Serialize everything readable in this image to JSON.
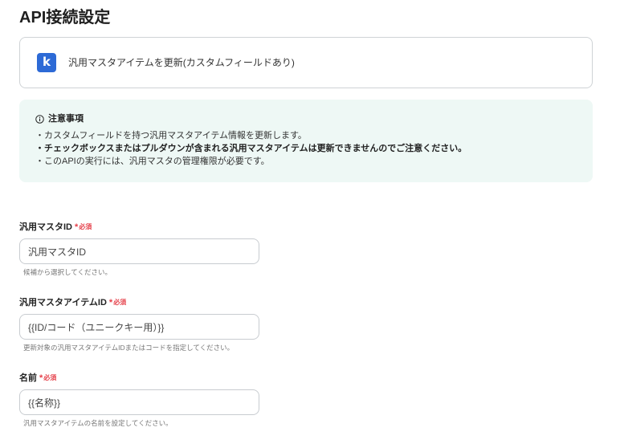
{
  "page": {
    "title": "API接続設定"
  },
  "colors": {
    "required": "#e5404a",
    "notice_bg": "#eef8f5",
    "app_icon": "#2d6ad6"
  },
  "action_card": {
    "icon": "kintone-logo-icon",
    "icon_letter": "k",
    "label": "汎用マスタアイテムを更新(カスタムフィールドあり)"
  },
  "notice": {
    "icon": "info-icon",
    "heading": "注意事項",
    "items": [
      "・カスタムフィールドを持つ汎用マスタアイテム情報を更新します。",
      "・チェックボックスまたはプルダウンが含まれる汎用マスタアイテムは更新できませんのでご注意ください。",
      "・このAPIの実行には、汎用マスタの管理権限が必要です。"
    ]
  },
  "form": {
    "required_mark": "*",
    "required_label": "必須",
    "fields": [
      {
        "label": "汎用マスタID",
        "value": "汎用マスタID",
        "help": "候補から選択してください。"
      },
      {
        "label": "汎用マスタアイテムID",
        "value": "{{ID/コード（ユニークキー用）}}",
        "help": "更新対象の汎用マスタアイテムIDまたはコードを指定してください。"
      },
      {
        "label": "名前",
        "value": "{{名称}}",
        "help": "汎用マスタアイテムの名前を設定してください。"
      }
    ]
  }
}
